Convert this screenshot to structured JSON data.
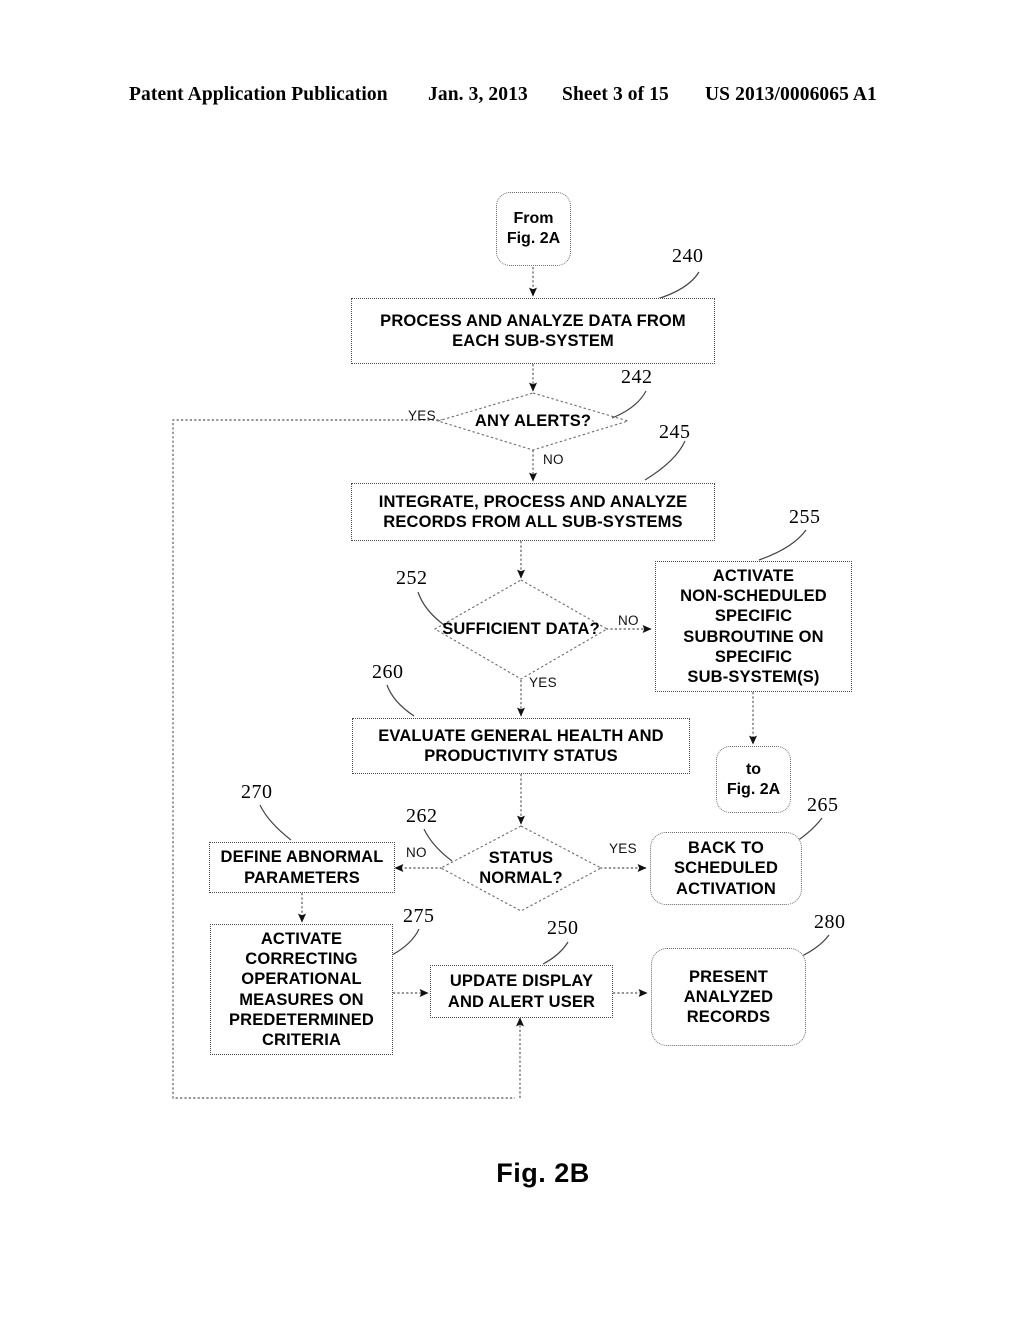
{
  "header": {
    "publication": "Patent Application Publication",
    "date": "Jan. 3, 2013",
    "sheet": "Sheet 3 of 15",
    "patent_number": "US 2013/0006065 A1"
  },
  "figure": {
    "caption": "Fig. 2B"
  },
  "nodes": {
    "from_fig2a": {
      "line1": "From",
      "line2": "Fig. 2A"
    },
    "process_analyze": {
      "line1": "PROCESS AND ANALYZE DATA FROM",
      "line2": "EACH SUB-SYSTEM"
    },
    "any_alerts": {
      "line1": "ANY ALERTS?"
    },
    "integrate": {
      "line1": "INTEGRATE, PROCESS AND ANALYZE",
      "line2": "RECORDS FROM ALL SUB-SYSTEMS"
    },
    "sufficient_data": {
      "line1": "SUFFICIENT",
      "line2": "DATA?"
    },
    "activate_nonsched": {
      "line1": "ACTIVATE",
      "line2": "NON-SCHEDULED",
      "line3": "SPECIFIC",
      "line4": "SUBROUTINE ON",
      "line5": "SPECIFIC",
      "line6": "SUB-SYSTEM(S)"
    },
    "to_fig2a": {
      "line1": "to",
      "line2": "Fig. 2A"
    },
    "evaluate_health": {
      "line1": "EVALUATE GENERAL HEALTH AND",
      "line2": "PRODUCTIVITY STATUS"
    },
    "status_normal": {
      "line1": "STATUS",
      "line2": "NORMAL?"
    },
    "define_abnormal": {
      "line1": "DEFINE ABNORMAL",
      "line2": "PARAMETERS"
    },
    "back_to_scheduled": {
      "line1": "BACK TO",
      "line2": "SCHEDULED",
      "line3": "ACTIVATION"
    },
    "activate_correcting": {
      "line1": "ACTIVATE",
      "line2": "CORRECTING",
      "line3": "OPERATIONAL",
      "line4": "MEASURES ON",
      "line5": "PREDETERMINED",
      "line6": "CRITERIA"
    },
    "update_display": {
      "line1": "UPDATE DISPLAY",
      "line2": "AND ALERT USER"
    },
    "present_records": {
      "line1": "PRESENT",
      "line2": "ANALYZED",
      "line3": "RECORDS"
    }
  },
  "branch_labels": {
    "alerts_yes": "YES",
    "alerts_no": "NO",
    "sufficient_no": "NO",
    "sufficient_yes": "YES",
    "status_no": "NO",
    "status_yes": "YES"
  },
  "reference_numerals": {
    "n240": "240",
    "n242": "242",
    "n245": "245",
    "n250": "250",
    "n252": "252",
    "n255": "255",
    "n260": "260",
    "n262": "262",
    "n265": "265",
    "n270": "270",
    "n275": "275",
    "n280": "280"
  },
  "colors": {
    "ink": "#000000",
    "paper": "#ffffff",
    "stroke": "#4a4a4a"
  }
}
